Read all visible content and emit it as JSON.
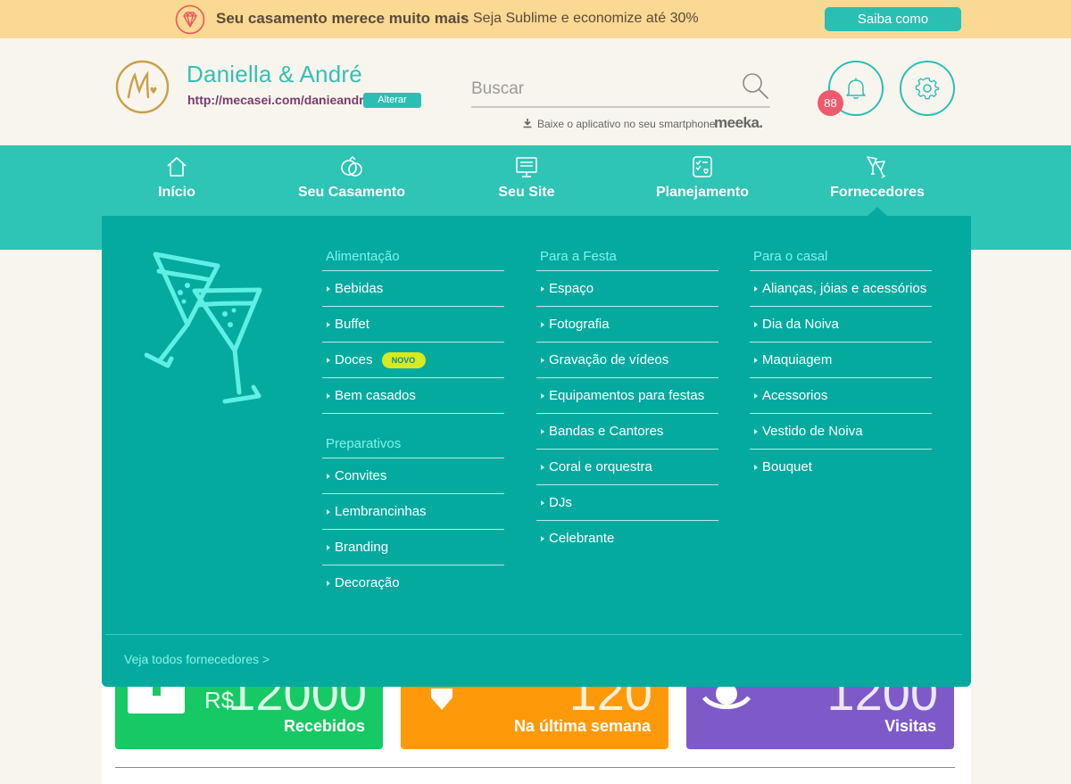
{
  "promo": {
    "headline": "Seu casamento merece muito mais",
    "separator": "-",
    "subtext": "Seja Sublime e economize até 30%",
    "cta_label": "Saiba como",
    "icon": "diamond-icon"
  },
  "header": {
    "logo_icon": "mecasei-logo",
    "couple_name": "Daniella & André",
    "site_url": "http://mecasei.com/danieandre",
    "change_label": "Alterar",
    "search_placeholder": "Buscar",
    "search_value": "",
    "app_text": "Baixe o aplicativo no seu smartphone",
    "app_brand": "meeka.",
    "notification_count": "88"
  },
  "nav": {
    "items": [
      {
        "label": "Início",
        "icon": "home-icon"
      },
      {
        "label": "Seu Casamento",
        "icon": "rings-icon"
      },
      {
        "label": "Seu Site",
        "icon": "monitor-icon"
      },
      {
        "label": "Planejamento",
        "icon": "checklist-icon"
      },
      {
        "label": "Fornecedores",
        "icon": "cocktail-icon"
      }
    ],
    "active": "Fornecedores"
  },
  "dropdown": {
    "columns": [
      {
        "groups": [
          {
            "title": "Alimentação",
            "items": [
              "Bebidas",
              "Buffet",
              "Doces",
              "Bem casados"
            ]
          },
          {
            "title": "Preparativos",
            "items": [
              "Convites",
              "Lembrancinhas",
              "Branding",
              "Decoração"
            ]
          }
        ]
      },
      {
        "groups": [
          {
            "title": "Para a Festa",
            "items": [
              "Espaço",
              "Fotografia",
              "Gravação de vídeos",
              "Equipamentos para festas",
              "Bandas e Cantores",
              "Coral e orquestra",
              "DJs",
              "Celebrante"
            ]
          }
        ]
      },
      {
        "groups": [
          {
            "title": "Para o casal",
            "items": [
              "Alianças, jóias e acessórios",
              "Dia da Noiva",
              "Maquiagem",
              "Acessorios",
              "Vestido de Noiva",
              "Bouquet"
            ]
          }
        ]
      }
    ],
    "new_badge": "NOVO",
    "see_all": "Veja todos fornecedores >"
  },
  "stats": {
    "cards": [
      {
        "currency": "R$",
        "value": "12000",
        "caption": "Recebidos",
        "color": "#17c964",
        "icon": "money-icon"
      },
      {
        "value": "120",
        "caption": "Na última semana",
        "color": "#fe9a09",
        "icon": "heart-icon"
      },
      {
        "value": "1200",
        "caption": "Visitas",
        "color": "#7e5ac8",
        "icon": "eye-icon"
      }
    ]
  },
  "colors": {
    "teal": "#2ec4b6",
    "dropdown": "#05aa9f",
    "promo": "#fad993",
    "badge": "#ee5a6d",
    "novo": "#d6ea1f"
  }
}
